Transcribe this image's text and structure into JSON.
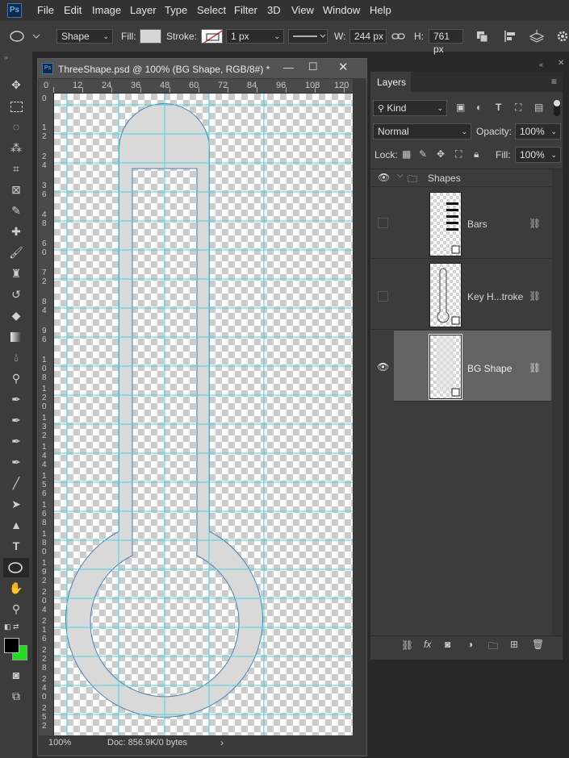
{
  "app": {
    "logo": "Ps"
  },
  "menu": [
    "File",
    "Edit",
    "Image",
    "Layer",
    "Type",
    "Select",
    "Filter",
    "3D",
    "View",
    "Window",
    "Help"
  ],
  "options": {
    "shape_mode": "Shape",
    "fill_label": "Fill:",
    "fill_color": "#d6d6d6",
    "stroke_label": "Stroke:",
    "stroke_width": "1 px",
    "w_label": "W:",
    "w_value": "244 px",
    "h_label": "H:",
    "h_value": "761 px"
  },
  "document": {
    "title": "ThreeShape.psd @ 100% (BG Shape, RGB/8#) *",
    "ruler_h": [
      "0",
      "12",
      "24",
      "36",
      "48",
      "60",
      "72",
      "84",
      "96",
      "108",
      "120"
    ],
    "ruler_v": [
      "0",
      "1 2",
      "2 4",
      "3 6",
      "4 8",
      "6 0",
      "7 2",
      "8 4",
      "9 6",
      "1 0 8",
      "1 2 0",
      "1 3 2",
      "1 4 4",
      "1 5 6",
      "1 6 8",
      "1 8 0",
      "1 9 2",
      "2 0 4",
      "2 1 6",
      "2 2 8",
      "2 4 0",
      "2 5 2"
    ],
    "zoom": "100%",
    "doc_info": "Doc: 856.9K/0 bytes",
    "shape_fill": "#d9d9d9",
    "shape_stroke": "#4d7fb5",
    "guide_color": "#3fd6e0"
  },
  "layers_panel": {
    "tab": "Layers",
    "filter": "Kind",
    "blend_mode": "Normal",
    "opacity_label": "Opacity:",
    "opacity": "100%",
    "lock_label": "Lock:",
    "fill_label": "Fill:",
    "fill": "100%",
    "group_name": "Shapes",
    "layers": [
      {
        "name": "Bars",
        "visible": false
      },
      {
        "name": "Key H...troke",
        "visible": false
      },
      {
        "name": "BG Shape",
        "visible": true,
        "selected": true
      }
    ]
  }
}
